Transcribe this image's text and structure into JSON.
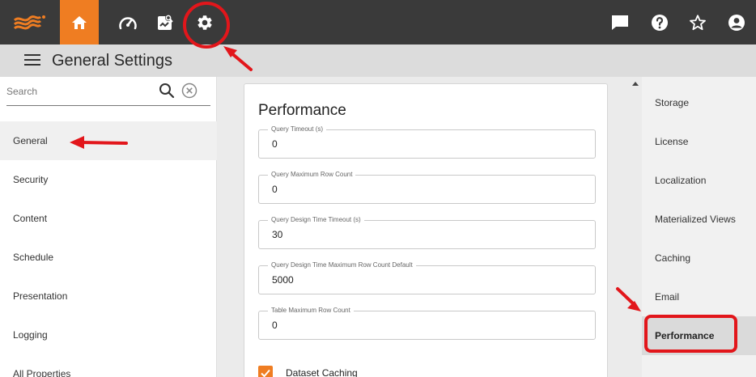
{
  "topbar": {
    "icons": [
      "logo-icon",
      "home-icon",
      "dashboard-icon",
      "reports-icon",
      "gear-icon",
      "chat-icon",
      "help-icon",
      "star-icon",
      "user-icon"
    ],
    "accent_color": "#ef7d22"
  },
  "header": {
    "title": "General Settings"
  },
  "sidebar": {
    "search_placeholder": "Search",
    "items": [
      {
        "label": "General"
      },
      {
        "label": "Security"
      },
      {
        "label": "Content"
      },
      {
        "label": "Schedule"
      },
      {
        "label": "Presentation"
      },
      {
        "label": "Logging"
      },
      {
        "label": "All Properties"
      }
    ]
  },
  "main": {
    "title": "Performance",
    "fields": [
      {
        "label": "Query Timeout (s)",
        "value": "0"
      },
      {
        "label": "Query Maximum Row Count",
        "value": "0"
      },
      {
        "label": "Query Design Time Timeout (s)",
        "value": "30"
      },
      {
        "label": "Query Design Time Maximum Row Count Default",
        "value": "5000"
      },
      {
        "label": "Table Maximum Row Count",
        "value": "0"
      }
    ],
    "checkbox": {
      "label": "Dataset Caching",
      "checked": true
    }
  },
  "rightnav": {
    "items": [
      {
        "label": "Storage"
      },
      {
        "label": "License"
      },
      {
        "label": "Localization"
      },
      {
        "label": "Materialized Views"
      },
      {
        "label": "Caching"
      },
      {
        "label": "Email"
      },
      {
        "label": "Performance"
      }
    ]
  },
  "annotation_color": "#e2161b"
}
